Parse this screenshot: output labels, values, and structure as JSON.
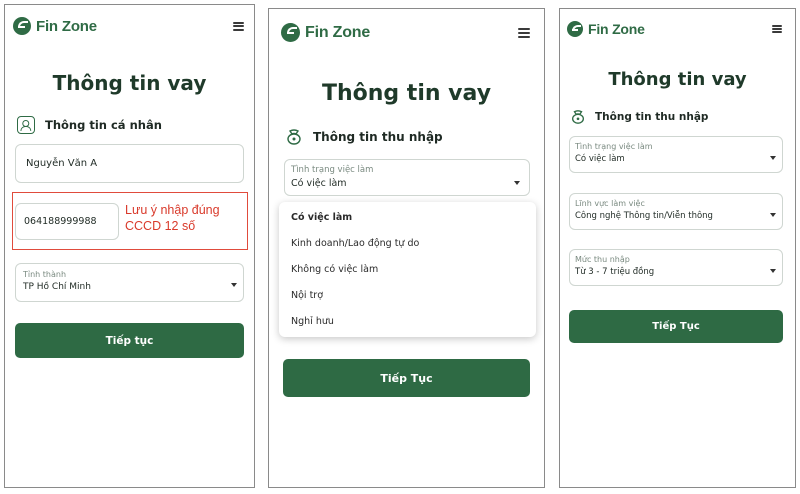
{
  "brand": {
    "name": "Fin Zone",
    "color": "#2f6b45",
    "logo_icon": "finzone-logo-icon",
    "menu_icon": "hamburger-menu-icon"
  },
  "screen1": {
    "title": "Thông tin vay",
    "section": "Thông tin cá nhân",
    "section_icon": "user-card-icon",
    "name_value": "Nguyễn Văn A",
    "id_value": "064188999988",
    "note": "Lưu ý nhập đúng CCCD 12 số",
    "province_label": "Tỉnh thành",
    "province_value": "TP Hồ Chí Minh",
    "continue": "Tiếp tục"
  },
  "screen2": {
    "title": "Thông tin vay",
    "section": "Thông tin thu nhập",
    "section_icon": "income-icon",
    "employment_label": "Tình trạng việc làm",
    "employment_value": "Có việc làm",
    "options": [
      "Có việc làm",
      "Kinh doanh/Lao động tự do",
      "Không có việc làm",
      "Nội trợ",
      "Nghỉ hưu"
    ],
    "continue": "Tiếp Tục"
  },
  "screen3": {
    "title": "Thông tin vay",
    "section": "Thông tin thu nhập",
    "section_icon": "income-icon",
    "employment_label": "Tình trạng việc làm",
    "employment_value": "Có việc làm",
    "field_label": "Lĩnh vực làm việc",
    "field_value": "Công nghệ Thông tin/Viễn thông",
    "income_label": "Mức thu nhập",
    "income_value": "Từ 3 - 7 triệu đồng",
    "continue": "Tiếp Tục"
  },
  "colors": {
    "primary": "#2e6a44",
    "note_red": "#d93a2b",
    "title": "#1f3a2a"
  }
}
